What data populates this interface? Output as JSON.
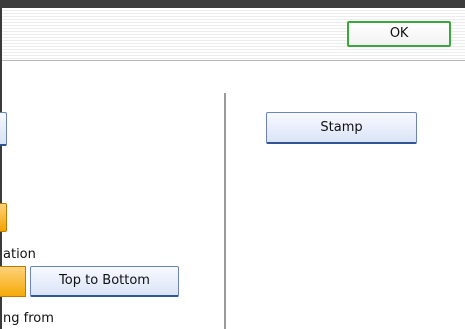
{
  "header": {
    "ok_label": "OK"
  },
  "left_panel": {
    "rotation_label": "ation",
    "top_to_bottom_label": "Top to Bottom",
    "numbering_label": "ng from"
  },
  "right_panel": {
    "stamp_label": "Stamp"
  },
  "colors": {
    "ok_border": "#3aa83c",
    "selected_orange": "#f4aa08",
    "button_blue_edge": "#2f5597",
    "top_bar": "#3c3c3c"
  }
}
